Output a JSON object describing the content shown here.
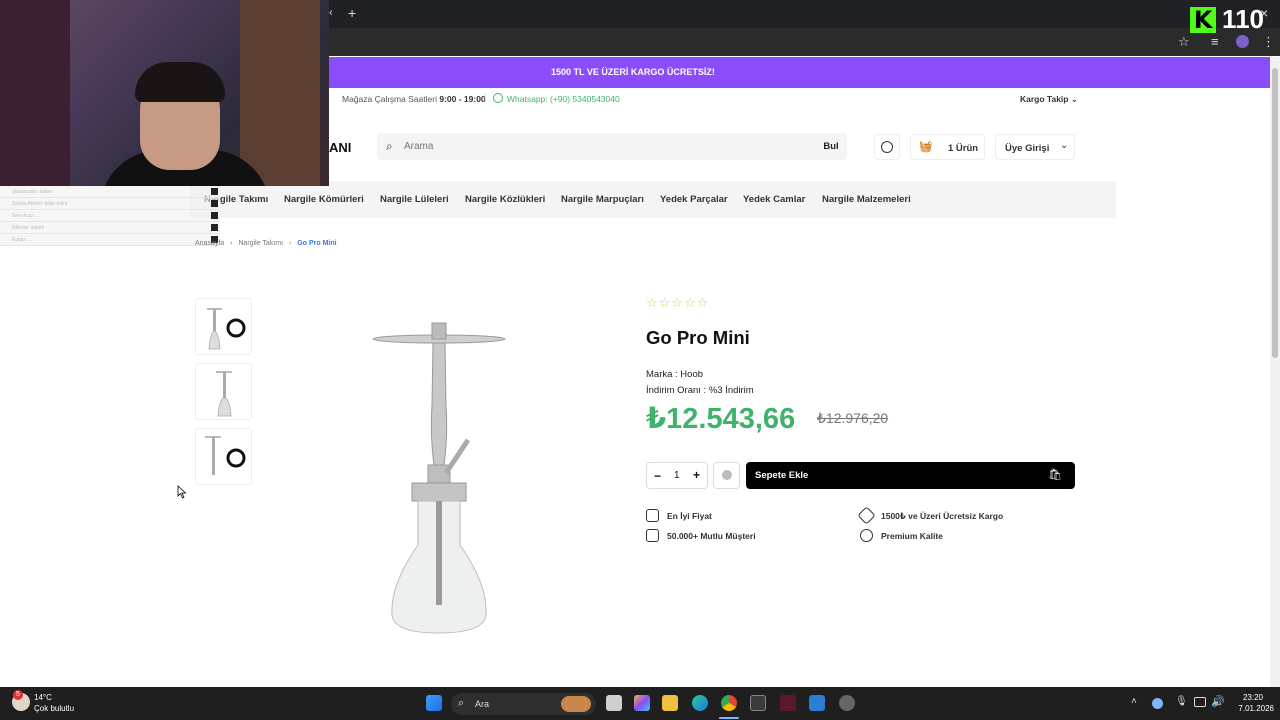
{
  "browser": {
    "new_tab": "+",
    "close": "×"
  },
  "stream": {
    "counter": "110",
    "chat_lines": [
      "glassmusic: naber",
      "Seyda Ahmet: takip ettim",
      "Sevi Acar: ...",
      "Riferlar: selam",
      "Kutun: ..."
    ]
  },
  "promo": "1500 TL VE ÜZERİ KARGO ÜCRETSİZ!",
  "infobar": {
    "hours_label": "Mağaza Çalışma Saatleri",
    "hours": "9:00 - 19:00",
    "whatsapp": "Whatsapp: (+90) 5340543040",
    "tracking": "Kargo Takip"
  },
  "header": {
    "logo_fragment": "ANI",
    "search_placeholder": "Arama",
    "search_button": "Bul",
    "cart": "1 Ürün",
    "login": "Üye Girişi"
  },
  "nav": [
    "Nargile Takımı",
    "Nargile Kömürleri",
    "Nargile Lüleleri",
    "Nargile Közlükleri",
    "Nargile Marpuçları",
    "Yedek Parçalar",
    "Yedek Camlar",
    "Nargile Malzemeleri"
  ],
  "breadcrumb": [
    "Anasayfa",
    "Nargile Takımı",
    "Go Pro Mini"
  ],
  "product": {
    "stars": "☆☆☆☆☆",
    "rating": 0,
    "name": "Go Pro Mini",
    "brand": "Marka : Hoob",
    "discount": "İndirim Oranı : %3 İndirim",
    "price": "₺12.543,66",
    "old_price": "₺12.976,20",
    "qty": "1",
    "minus": "−",
    "plus": "+",
    "add_to_cart": "Sepete Ekle",
    "features": [
      "En İyi Fiyat",
      "1500₺ ve Üzeri Ücretsiz Kargo",
      "50.000+ Mutlu Müşteri",
      "Premium Kalite"
    ]
  },
  "taskbar": {
    "weather_temp": "14°C",
    "weather_desc": "Çok bulutlu",
    "weather_badge": "5",
    "search": "Ara",
    "time": "23:20",
    "date": "7.01.2026"
  },
  "colors": {
    "promo": "#8b4dfa",
    "price": "#3db36b",
    "whatsapp": "#3db36b"
  }
}
